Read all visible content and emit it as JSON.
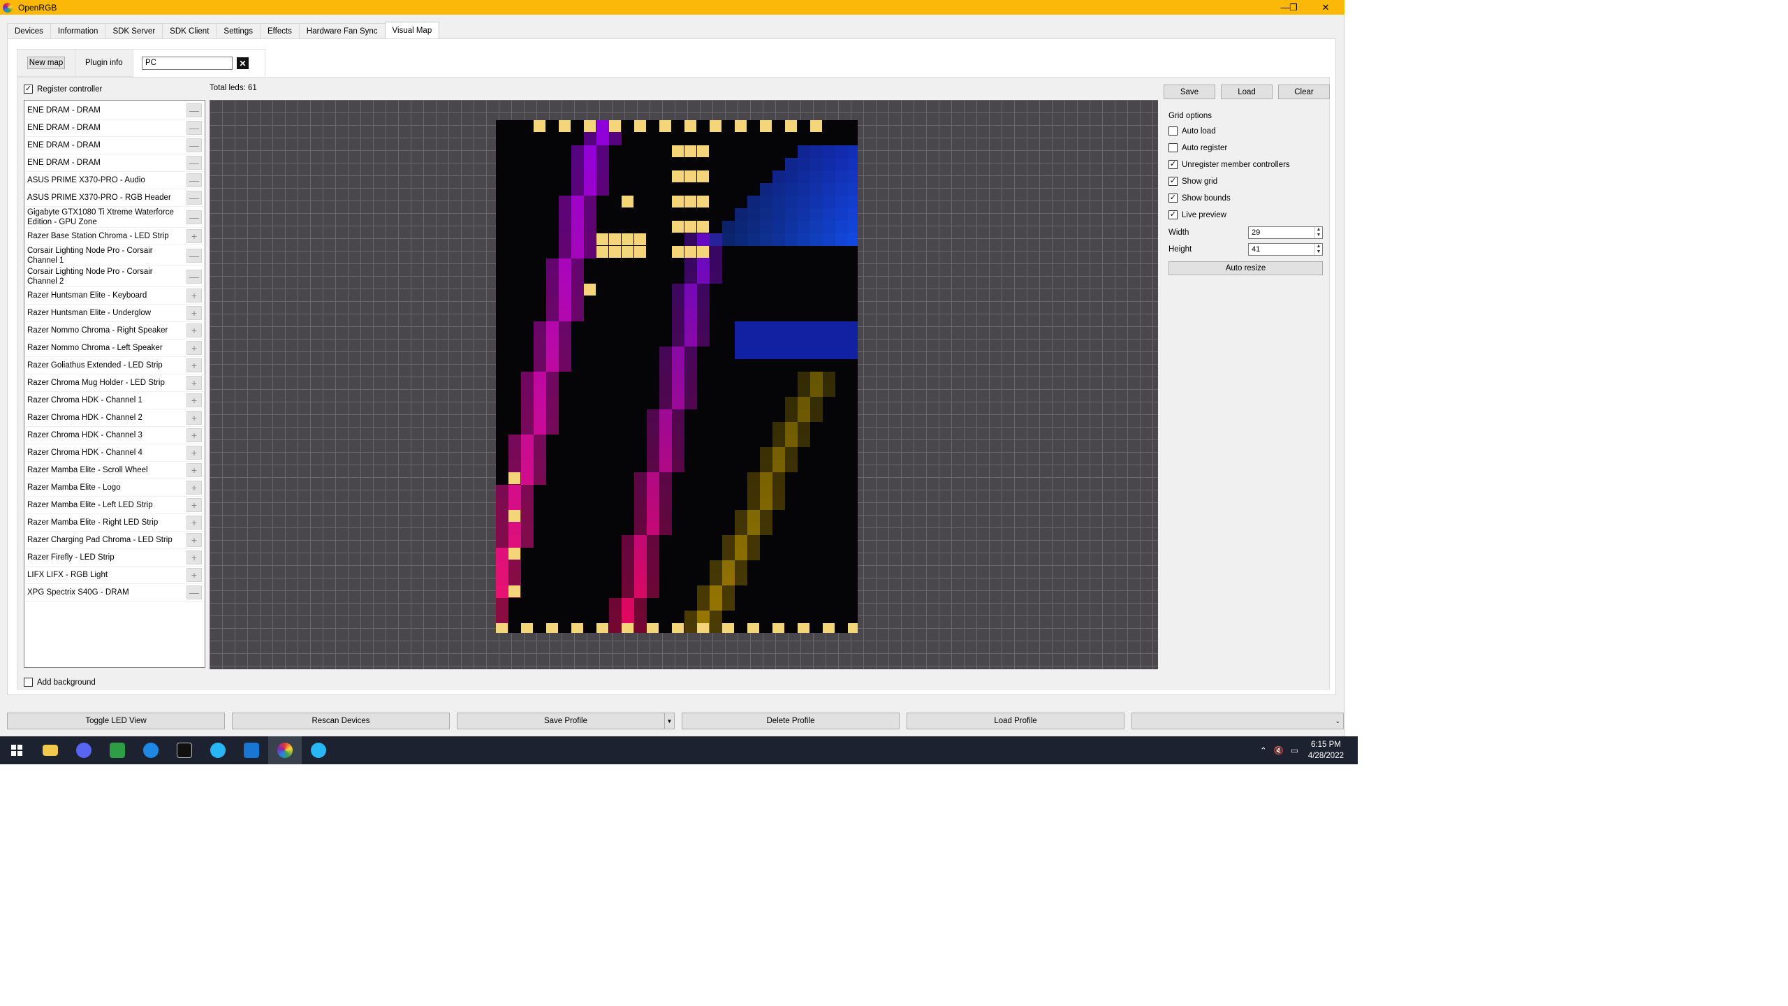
{
  "app": {
    "title": "OpenRGB"
  },
  "window_buttons": {
    "minimize": "—",
    "restore": "❐",
    "close": "✕"
  },
  "tabs": [
    "Devices",
    "Information",
    "SDK Server",
    "SDK Client",
    "Settings",
    "Effects",
    "Hardware Fan Sync",
    "Visual Map"
  ],
  "active_tab": "Visual Map",
  "subtabs": {
    "new_map": "New map",
    "plugin_info": "Plugin info",
    "map_name": "PC"
  },
  "register_controller": {
    "label": "Register controller",
    "checked": true
  },
  "total_leds": "Total leds: 61",
  "controllers": [
    {
      "name": "ENE DRAM - DRAM",
      "action": "—"
    },
    {
      "name": "ENE DRAM - DRAM",
      "action": "—"
    },
    {
      "name": "ENE DRAM - DRAM",
      "action": "—"
    },
    {
      "name": "ENE DRAM - DRAM",
      "action": "—"
    },
    {
      "name": "ASUS PRIME X370-PRO - Audio",
      "action": "—"
    },
    {
      "name": "ASUS PRIME X370-PRO - RGB Header",
      "action": "—"
    },
    {
      "name": "Gigabyte GTX1080 Ti Xtreme Waterforce Edition - GPU Zone",
      "action": "—"
    },
    {
      "name": "Razer Base Station Chroma - LED Strip",
      "action": "+"
    },
    {
      "name": "Corsair Lighting Node Pro - Corsair Channel 1",
      "action": "—"
    },
    {
      "name": "Corsair Lighting Node Pro - Corsair Channel 2",
      "action": "—"
    },
    {
      "name": "Razer Huntsman Elite - Keyboard",
      "action": "+"
    },
    {
      "name": "Razer Huntsman Elite - Underglow",
      "action": "+"
    },
    {
      "name": "Razer Nommo Chroma - Right Speaker",
      "action": "+"
    },
    {
      "name": "Razer Nommo Chroma - Left Speaker",
      "action": "+"
    },
    {
      "name": "Razer Goliathus Extended - LED Strip",
      "action": "+"
    },
    {
      "name": "Razer Chroma Mug Holder - LED Strip",
      "action": "+"
    },
    {
      "name": "Razer Chroma HDK - Channel 1",
      "action": "+"
    },
    {
      "name": "Razer Chroma HDK - Channel 2",
      "action": "+"
    },
    {
      "name": "Razer Chroma HDK - Channel 3",
      "action": "+"
    },
    {
      "name": "Razer Chroma HDK - Channel 4",
      "action": "+"
    },
    {
      "name": "Razer Mamba Elite - Scroll Wheel",
      "action": "+"
    },
    {
      "name": "Razer Mamba Elite - Logo",
      "action": "+"
    },
    {
      "name": "Razer Mamba Elite - Left LED Strip",
      "action": "+"
    },
    {
      "name": "Razer Mamba Elite - Right LED Strip",
      "action": "+"
    },
    {
      "name": "Razer Charging Pad Chroma - LED Strip",
      "action": "+"
    },
    {
      "name": "Razer Firefly - LED Strip",
      "action": "+"
    },
    {
      "name": "LIFX LIFX - RGB Light",
      "action": "+"
    },
    {
      "name": "XPG Spectrix S40G - DRAM",
      "action": "—"
    }
  ],
  "add_background": {
    "label": "Add background",
    "checked": false
  },
  "map_buttons": {
    "save": "Save",
    "load": "Load",
    "clear": "Clear"
  },
  "grid_options": {
    "title": "Grid options",
    "auto_load": {
      "label": "Auto load",
      "checked": false
    },
    "auto_register": {
      "label": "Auto register",
      "checked": false
    },
    "unregister_members": {
      "label": "Unregister member controllers",
      "checked": true
    },
    "show_grid": {
      "label": "Show grid",
      "checked": true
    },
    "show_bounds": {
      "label": "Show bounds",
      "checked": true
    },
    "live_preview": {
      "label": "Live preview",
      "checked": true
    },
    "width_label": "Width",
    "width_value": "29",
    "height_label": "Height",
    "height_value": "41",
    "auto_resize": "Auto resize"
  },
  "bottom_buttons": {
    "toggle_led_view": "Toggle LED View",
    "rescan": "Rescan Devices",
    "save_profile": "Save Profile",
    "delete_profile": "Delete Profile",
    "load_profile": "Load Profile",
    "profile_select": ""
  },
  "colors": {
    "titlebar": "#fbb808",
    "led": "#f5d57a",
    "grid_bg": "#4a474c",
    "preview_bg": "#050508"
  },
  "taskbar": {
    "icons": [
      "windows-start-icon",
      "file-explorer-icon",
      "discord-icon",
      "qbittorrent-icon",
      "app-icon",
      "terminal-icon",
      "browser-icon",
      "vscode-icon",
      "openrgb-icon",
      "browser-icon-2"
    ],
    "time": "6:15 PM",
    "date": "4/28/2022"
  }
}
